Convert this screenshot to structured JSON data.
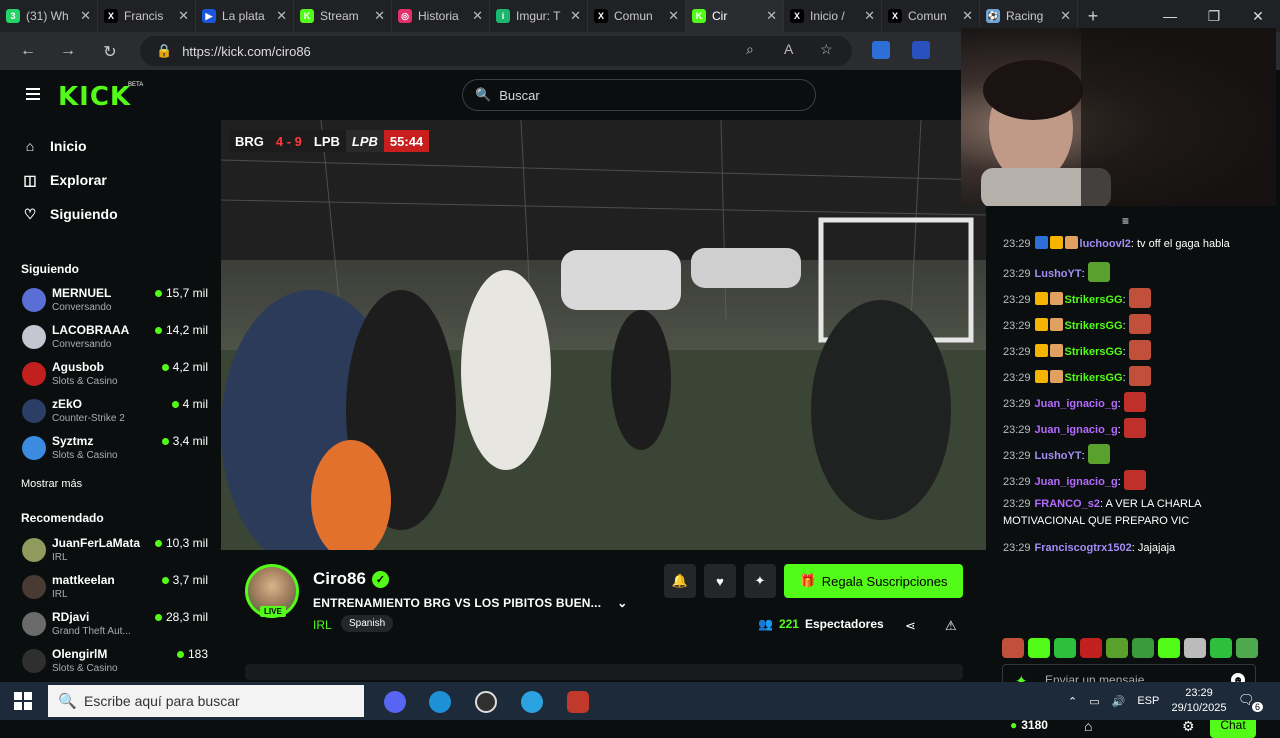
{
  "browser": {
    "tabs": [
      {
        "title": "(31) Wh",
        "icon": "whatsapp-icon",
        "color": "#25d366",
        "glyph": "3"
      },
      {
        "title": "Francis",
        "icon": "x-icon",
        "color": "#000000",
        "glyph": "X"
      },
      {
        "title": "La plata",
        "icon": "page-icon",
        "color": "#1a56db",
        "glyph": "▶"
      },
      {
        "title": "Stream",
        "icon": "kick-icon",
        "color": "#53fc18",
        "glyph": "K"
      },
      {
        "title": "Historia",
        "icon": "instagram-icon",
        "color": "#e1306c",
        "glyph": "◎"
      },
      {
        "title": "Imgur: T",
        "icon": "imgur-icon",
        "color": "#1bb76e",
        "glyph": "i"
      },
      {
        "title": "Comun",
        "icon": "x-icon",
        "color": "#000000",
        "glyph": "X"
      },
      {
        "title": "Cir",
        "icon": "kick-icon",
        "color": "#53fc18",
        "glyph": "K",
        "active": true
      },
      {
        "title": "Inicio /",
        "icon": "x-icon",
        "color": "#000000",
        "glyph": "X"
      },
      {
        "title": "Comun",
        "icon": "x-icon",
        "color": "#000000",
        "glyph": "X"
      },
      {
        "title": "Racing",
        "icon": "racing-icon",
        "color": "#6aa6d9",
        "glyph": "⚽"
      }
    ],
    "url": "https://kick.com/ciro86"
  },
  "kick": {
    "logo": "KICK",
    "beta": "BETA",
    "search_placeholder": "Buscar",
    "nav": [
      {
        "label": "Inicio",
        "icon": "home-icon"
      },
      {
        "label": "Explorar",
        "icon": "compass-icon"
      },
      {
        "label": "Siguiendo",
        "icon": "heart-icon"
      }
    ],
    "following_heading": "Siguiendo",
    "following": [
      {
        "name": "MERNUEL",
        "category": "Conversando",
        "viewers": "15,7 mil",
        "avatar": "#5a6fd6"
      },
      {
        "name": "LACOBRAAA",
        "category": "Conversando",
        "viewers": "14,2 mil",
        "avatar": "#c4c7d0"
      },
      {
        "name": "Agusbob",
        "category": "Slots & Casino",
        "viewers": "4,2 mil",
        "avatar": "#c21f1f"
      },
      {
        "name": "zEkO",
        "category": "Counter-Strike 2",
        "viewers": "4 mil",
        "avatar": "#2c3e66"
      },
      {
        "name": "Syztmz",
        "category": "Slots & Casino",
        "viewers": "3,4 mil",
        "avatar": "#3b8ce0"
      }
    ],
    "show_more": "Mostrar más",
    "recommended_heading": "Recomendado",
    "recommended": [
      {
        "name": "JuanFerLaMata",
        "category": "IRL",
        "viewers": "10,3 mil",
        "avatar": "#8f9a5c"
      },
      {
        "name": "mattkeelan",
        "category": "IRL",
        "viewers": "3,7 mil",
        "avatar": "#4a3a34"
      },
      {
        "name": "RDjavi",
        "category": "Grand Theft Aut...",
        "viewers": "28,3 mil",
        "avatar": "#6b6b6b"
      },
      {
        "name": "OlengirlM",
        "category": "Slots & Casino",
        "viewers": "183",
        "avatar": "#2f2f2f"
      }
    ]
  },
  "scoreboard": {
    "team1": "BRG",
    "score": "4 - 9",
    "team2": "LPB",
    "team2_badge": "LPB",
    "clock": "55:44"
  },
  "stream": {
    "channel": "Ciro86",
    "live": "LIVE",
    "title": "ENTRENAMIENTO BRG VS LOS PIBITOS BUEN...",
    "category": "IRL",
    "language": "Spanish",
    "subscribe_label": "Regala Suscripciones",
    "viewers_count": "221",
    "viewers_label": "Espectadores"
  },
  "chat": {
    "messages": [
      {
        "time": "23:29",
        "badges": [
          "#2d6fd6",
          "#f5b400",
          "#e0a060"
        ],
        "user": "luchoovl2",
        "color": "#a48cf5",
        "text": "tv off el gaga habla"
      },
      {
        "time": "23:29",
        "badges": [],
        "user": "LushoYT",
        "color": "#a48cf5",
        "emote": "#5aa02c"
      },
      {
        "time": "23:29",
        "badges": [
          "#f5b400",
          "#e0a060"
        ],
        "user": "StrikersGG",
        "color": "#53fc18",
        "emote": "#c0503a"
      },
      {
        "time": "23:29",
        "badges": [
          "#f5b400",
          "#e0a060"
        ],
        "user": "StrikersGG",
        "color": "#53fc18",
        "emote": "#c0503a"
      },
      {
        "time": "23:29",
        "badges": [
          "#f5b400",
          "#e0a060"
        ],
        "user": "StrikersGG",
        "color": "#53fc18",
        "emote": "#c0503a"
      },
      {
        "time": "23:29",
        "badges": [
          "#f5b400",
          "#e0a060"
        ],
        "user": "StrikersGG",
        "color": "#53fc18",
        "emote": "#c0503a"
      },
      {
        "time": "23:29",
        "badges": [],
        "user": "Juan_ignacio_g",
        "color": "#b36bff",
        "emote": "#c0302a"
      },
      {
        "time": "23:29",
        "badges": [],
        "user": "Juan_ignacio_g",
        "color": "#b36bff",
        "emote": "#c0302a"
      },
      {
        "time": "23:29",
        "badges": [],
        "user": "LushoYT",
        "color": "#a48cf5",
        "emote": "#5aa02c"
      },
      {
        "time": "23:29",
        "badges": [],
        "user": "Juan_ignacio_g",
        "color": "#b36bff",
        "emote": "#c0302a"
      },
      {
        "time": "23:29",
        "badges": [],
        "user": "FRANCO_s2",
        "color": "#b36bff",
        "text": "A VER LA CHARLA MOTIVACIONAL QUE PREPARO VIC"
      },
      {
        "time": "23:29",
        "badges": [],
        "user": "Franciscogtrx1502",
        "color": "#a48cf5",
        "text": "Jajajaja"
      }
    ],
    "emote_colors": [
      "#c0503a",
      "#53fc18",
      "#2fbf3f",
      "#c21f1f",
      "#5aa02c",
      "#3b9a3b",
      "#53fc18",
      "#bbbbbb",
      "#2fbf3f",
      "#4ea84e"
    ],
    "input_placeholder": "Enviar un mensaje",
    "points": "3180",
    "chat_button": "Chat"
  },
  "taskbar": {
    "search_placeholder": "Escribe aquí para buscar",
    "lang": "ESP",
    "time": "23:29",
    "date": "29/10/2025",
    "notification_count": "6"
  }
}
